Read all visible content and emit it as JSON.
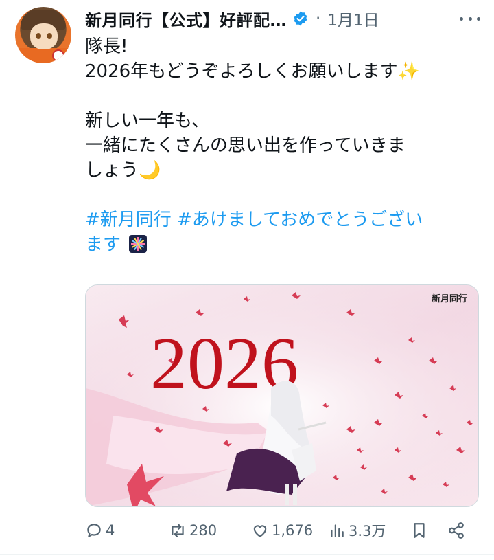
{
  "post": {
    "author_name": "新月同行【公式】好評配…",
    "separator": "·",
    "date": "1月1日",
    "text_lines": [
      "隊長!",
      "2026年もどうぞよろしくお願いします✨",
      "新しい一年も、",
      "一緒にたくさんの思い出を作っていきま",
      "しょう🌙"
    ],
    "hashtag_line1": "#新月同行 #あけましておめでとうござい",
    "hashtag_line2": "ます",
    "image": {
      "watermark": "新月同行",
      "year_text": "2026"
    }
  },
  "actions": {
    "replies": "4",
    "reposts": "280",
    "likes": "1,676",
    "views": "3.3万"
  },
  "icons": [
    "verified-badge-icon",
    "more-options-icon",
    "reply-icon",
    "repost-icon",
    "like-icon",
    "views-icon",
    "bookmark-icon",
    "share-icon"
  ],
  "colors": {
    "accent": "#1d9bf0",
    "muted": "#536471",
    "year_red": "#c0121d"
  }
}
